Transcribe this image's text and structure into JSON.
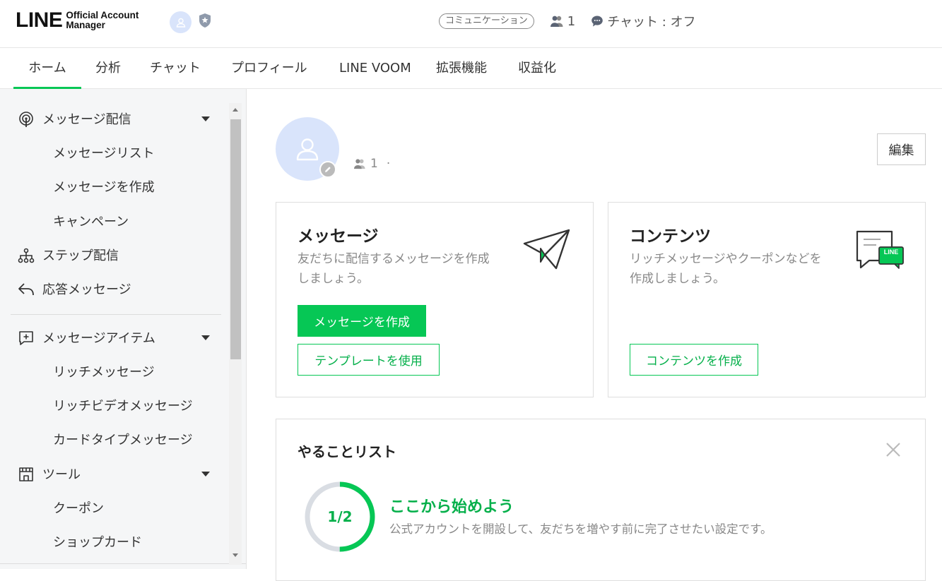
{
  "header": {
    "logo_main": "LINE",
    "logo_sub_1": "Official Account",
    "logo_sub_2": "Manager",
    "plan_pill": "コミュニケーション",
    "friends_count": "1",
    "chat_status": "チャット : オフ"
  },
  "tabs": [
    {
      "label": "ホーム",
      "active": true
    },
    {
      "label": "分析"
    },
    {
      "label": "チャット"
    },
    {
      "label": "プロフィール"
    },
    {
      "label": "LINE VOOM"
    },
    {
      "label": "拡張機能"
    },
    {
      "label": "収益化"
    }
  ],
  "sidebar": {
    "groups": [
      {
        "label": "メッセージ配信",
        "icon": "broadcast-icon",
        "expandable": true,
        "children": [
          "メッセージリスト",
          "メッセージを作成",
          "キャンペーン"
        ]
      },
      {
        "label": "ステップ配信",
        "icon": "step-tree-icon"
      },
      {
        "label": "応答メッセージ",
        "icon": "reply-arrow-icon"
      },
      {
        "label": "メッセージアイテム",
        "icon": "add-message-icon",
        "expandable": true,
        "children": [
          "リッチメッセージ",
          "リッチビデオメッセージ",
          "カードタイプメッセージ"
        ]
      },
      {
        "label": "ツール",
        "icon": "shop-icon",
        "expandable": true,
        "children": [
          "クーポン",
          "ショップカード"
        ]
      }
    ]
  },
  "profile": {
    "friends_count": "1",
    "separator": "·",
    "edit_label": "編集"
  },
  "message_card": {
    "title": "メッセージ",
    "desc_line1": "友だちに配信するメッセージを作成",
    "desc_line2": "しましょう。",
    "primary_button": "メッセージを作成",
    "secondary_button": "テンプレートを使用"
  },
  "content_card": {
    "title": "コンテンツ",
    "desc_line1": "リッチメッセージやクーポンなどを",
    "desc_line2": "作成しましょう。",
    "button": "コンテンツを作成",
    "badge": "LINE"
  },
  "todo": {
    "title": "やることリスト",
    "progress_label": "1/2",
    "progress_fraction": 0.5,
    "heading": "ここから始めよう",
    "subtext": "公式アカウントを開設して、友だちを増やす前に完了させたい設定です。"
  },
  "colors": {
    "accent": "#06c755",
    "avatar_bg": "#d9e4fb"
  }
}
